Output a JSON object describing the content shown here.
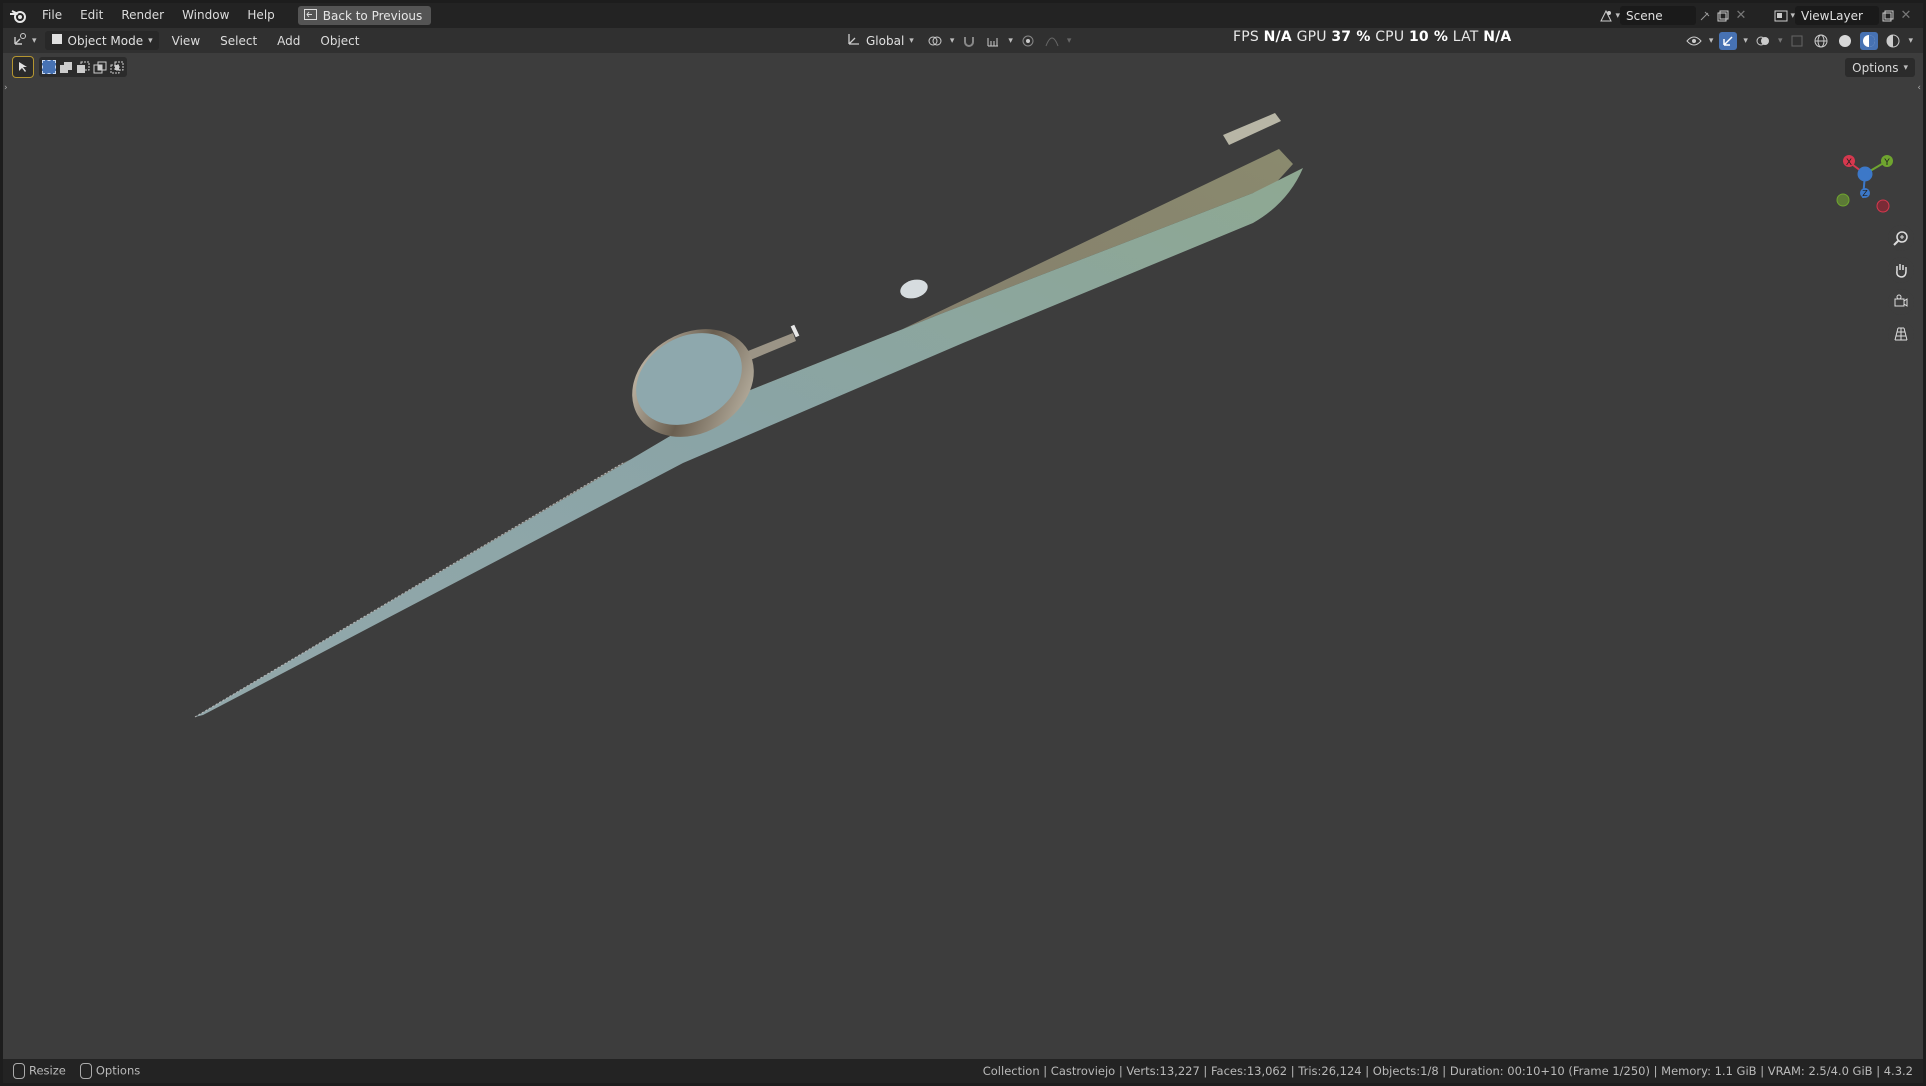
{
  "topbar": {
    "menus": [
      "File",
      "Edit",
      "Render",
      "Window",
      "Help"
    ],
    "back_label": "Back to Previous",
    "scene_name": "Scene",
    "view_layer_name": "ViewLayer"
  },
  "header": {
    "mode_label": "Object Mode",
    "menus": [
      "View",
      "Select",
      "Add",
      "Object"
    ],
    "orientation_label": "Global",
    "stats": {
      "fps_label": "FPS",
      "fps_value": "N/A",
      "gpu_label": "GPU",
      "gpu_value": "37 %",
      "cpu_label": "CPU",
      "cpu_value": "10 %",
      "lat_label": "LAT",
      "lat_value": "N/A"
    }
  },
  "viewport": {
    "options_label": "Options",
    "gizmo_axes": [
      "X",
      "Y",
      "Z"
    ]
  },
  "statusbar": {
    "resize_label": "Resize",
    "options_label": "Options",
    "info": "Collection | Castroviejo | Verts:13,227 | Faces:13,062 | Tris:26,124 | Objects:1/8 | Duration: 00:10+10 (Frame 1/250) | Memory: 1.1 GiB | VRAM: 2.5/4.0 GiB | 4.3.2"
  },
  "colors": {
    "viewport_bg": "#3d3d3d",
    "accent": "#4772b3",
    "axis_x": "#d6384e",
    "axis_y": "#6fa52f",
    "axis_z": "#3c78c8"
  }
}
